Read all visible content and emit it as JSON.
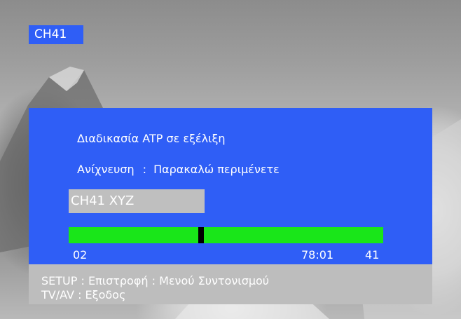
{
  "badge": {
    "channel": "CH41"
  },
  "dialog": {
    "status_text": "Διαδικασία ATP σε εξέλιξη",
    "search_label": "Ανίχνευση",
    "search_separator": ":",
    "search_value": "Παρακαλώ περιμένετε",
    "channel_name": "CH41  XYZ",
    "progress": {
      "fraction": 0.42,
      "start_value": "02",
      "frequency": "78:01",
      "channel_number": "41"
    }
  },
  "help": {
    "line1": "SETUP : Επιστροφή : Μενού Συντονισμού",
    "line2": "TV/AV : Εξοδος"
  },
  "colors": {
    "panel_blue": "#2f5ef6",
    "progress_green": "#19e619",
    "help_gray": "#bdbdbd",
    "channel_box_gray": "#bfbfbf"
  }
}
